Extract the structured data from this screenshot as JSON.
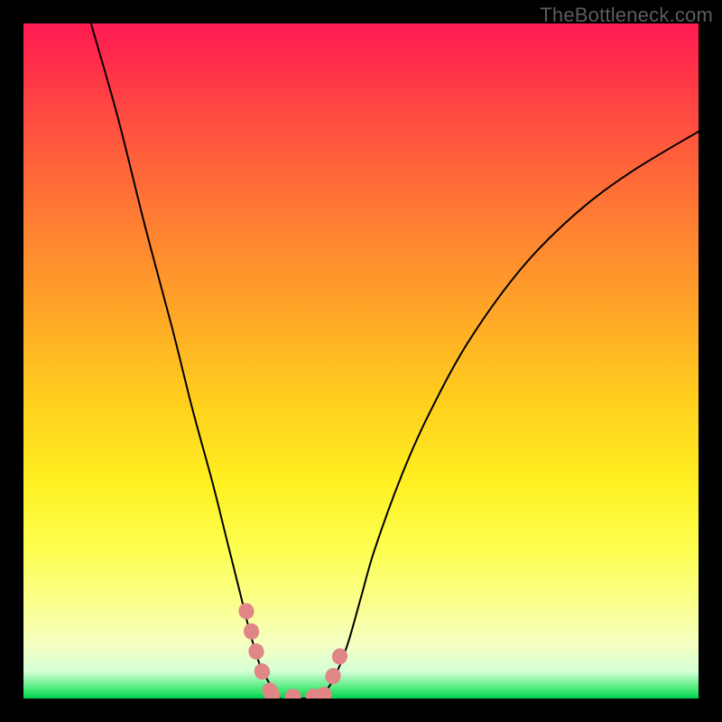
{
  "watermark": "TheBottleneck.com",
  "chart_data": {
    "type": "line",
    "title": "",
    "xlabel": "",
    "ylabel": "",
    "xlim": [
      0,
      100
    ],
    "ylim": [
      0,
      100
    ],
    "grid": false,
    "legend": false,
    "series": [
      {
        "name": "curve-left",
        "style": "solid-black",
        "x": [
          10,
          14,
          18,
          22,
          25,
          28,
          30,
          32,
          33.5,
          35,
          36,
          38,
          40,
          42,
          44
        ],
        "y": [
          100,
          86,
          70,
          55,
          43,
          32,
          24,
          16,
          10,
          5,
          3,
          0,
          0,
          0,
          0
        ]
      },
      {
        "name": "curve-right",
        "style": "solid-black",
        "x": [
          44,
          46,
          48,
          50,
          52,
          56,
          60,
          66,
          74,
          82,
          90,
          100
        ],
        "y": [
          0,
          3,
          8,
          15,
          22,
          33,
          42,
          53,
          64,
          72,
          78,
          84
        ]
      },
      {
        "name": "highlight-left",
        "style": "thick-salmon",
        "x": [
          33,
          34,
          35,
          36,
          36.8
        ],
        "y": [
          13,
          9,
          5,
          2.5,
          0.5
        ]
      },
      {
        "name": "highlight-bottom",
        "style": "thick-salmon",
        "x": [
          36.8,
          38.5,
          40.5,
          42.5,
          44.5
        ],
        "y": [
          0.5,
          0.3,
          0.3,
          0.3,
          0.5
        ]
      },
      {
        "name": "highlight-right",
        "style": "thick-salmon",
        "x": [
          44.5,
          45.5,
          46.5,
          47.3
        ],
        "y": [
          0.5,
          2.5,
          5,
          8
        ]
      }
    ],
    "colors": {
      "black": "#000000",
      "salmon": "#e08686",
      "gradient_top": "#ff1a53",
      "gradient_bottom": "#00cc55"
    }
  }
}
